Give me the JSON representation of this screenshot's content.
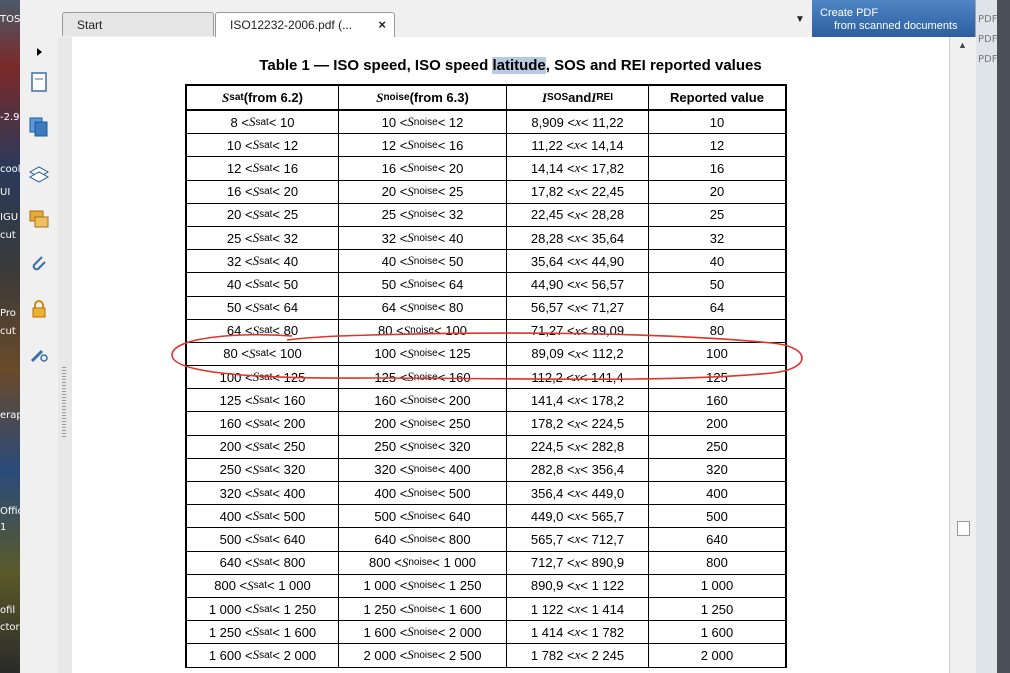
{
  "desktop": {
    "left_fragments": [
      "TOS",
      "-2.9",
      "cool",
      "UI",
      "IGU",
      "cut",
      "Pro",
      "cut",
      "erap",
      "Offic",
      "1",
      "ofil",
      "ctor"
    ],
    "right_fragments": [
      "PDF",
      "PDF",
      "PDF"
    ]
  },
  "tabs": [
    {
      "label": "Start"
    },
    {
      "label": "ISO12232-2006.pdf (...",
      "close": "×"
    }
  ],
  "tab_dropdown": "▼",
  "promo": {
    "line1": "Create PDF",
    "line2": "from scanned documents"
  },
  "sidebar_icons": [
    "expand-arrow-icon",
    "page-icon",
    "pages-icon",
    "layers-icon",
    "comment-icon",
    "attachment-icon",
    "lock-icon",
    "tools-icon"
  ],
  "document": {
    "title_before": "Table 1 — ISO speed, ISO speed ",
    "title_highlight": "latitude",
    "title_after": ", SOS and REI reported values",
    "headers": [
      {
        "var": "S",
        "sub": "sat",
        "rest": " (from 6.2)"
      },
      {
        "var": "S",
        "sub": "noise",
        "rest": " (from 6.3)"
      },
      {
        "var": "I",
        "sub": "SOS",
        "mid": " and ",
        "var2": "I",
        "sub2": "REI"
      },
      {
        "text": "Reported value"
      }
    ],
    "rows": [
      [
        "8",
        "10",
        "10",
        "12",
        "8,909",
        "11,22",
        "10"
      ],
      [
        "10",
        "12",
        "12",
        "16",
        "11,22",
        "14,14",
        "12"
      ],
      [
        "12",
        "16",
        "16",
        "20",
        "14,14",
        "17,82",
        "16"
      ],
      [
        "16",
        "20",
        "20",
        "25",
        "17,82",
        "22,45",
        "20"
      ],
      [
        "20",
        "25",
        "25",
        "32",
        "22,45",
        "28,28",
        "25"
      ],
      [
        "25",
        "32",
        "32",
        "40",
        "28,28",
        "35,64",
        "32"
      ],
      [
        "32",
        "40",
        "40",
        "50",
        "35,64",
        "44,90",
        "40"
      ],
      [
        "40",
        "50",
        "50",
        "64",
        "44,90",
        "56,57",
        "50"
      ],
      [
        "50",
        "64",
        "64",
        "80",
        "56,57",
        "71,27",
        "64"
      ],
      [
        "64",
        "80",
        "80",
        "100",
        "71,27",
        "89,09",
        "80"
      ],
      [
        "80",
        "100",
        "100",
        "125",
        "89,09",
        "112,2",
        "100"
      ],
      [
        "100",
        "125",
        "125",
        "160",
        "112,2",
        "141,4",
        "125"
      ],
      [
        "125",
        "160",
        "160",
        "200",
        "141,4",
        "178,2",
        "160"
      ],
      [
        "160",
        "200",
        "200",
        "250",
        "178,2",
        "224,5",
        "200"
      ],
      [
        "200",
        "250",
        "250",
        "320",
        "224,5",
        "282,8",
        "250"
      ],
      [
        "250",
        "320",
        "320",
        "400",
        "282,8",
        "356,4",
        "320"
      ],
      [
        "320",
        "400",
        "400",
        "500",
        "356,4",
        "449,0",
        "400"
      ],
      [
        "400",
        "500",
        "500",
        "640",
        "449,0",
        "565,7",
        "500"
      ],
      [
        "500",
        "640",
        "640",
        "800",
        "565,7",
        "712,7",
        "640"
      ],
      [
        "640",
        "800",
        "800",
        "1 000",
        "712,7",
        "890,9",
        "800"
      ],
      [
        "800",
        "1 000",
        "1 000",
        "1 250",
        "890,9",
        "1 122",
        "1 000"
      ],
      [
        "1 000",
        "1 250",
        "1 250",
        "1 600",
        "1 122",
        "1 414",
        "1 250"
      ],
      [
        "1 250",
        "1 600",
        "1 600",
        "2 000",
        "1 414",
        "1 782",
        "1 600"
      ],
      [
        "1 600",
        "2 000",
        "2 000",
        "2 500",
        "1 782",
        "2 245",
        "2 000"
      ]
    ],
    "highlighted_row_value": "100",
    "colors": {
      "annotation": "#e0342a",
      "highlight": "#b9c9e2"
    }
  }
}
